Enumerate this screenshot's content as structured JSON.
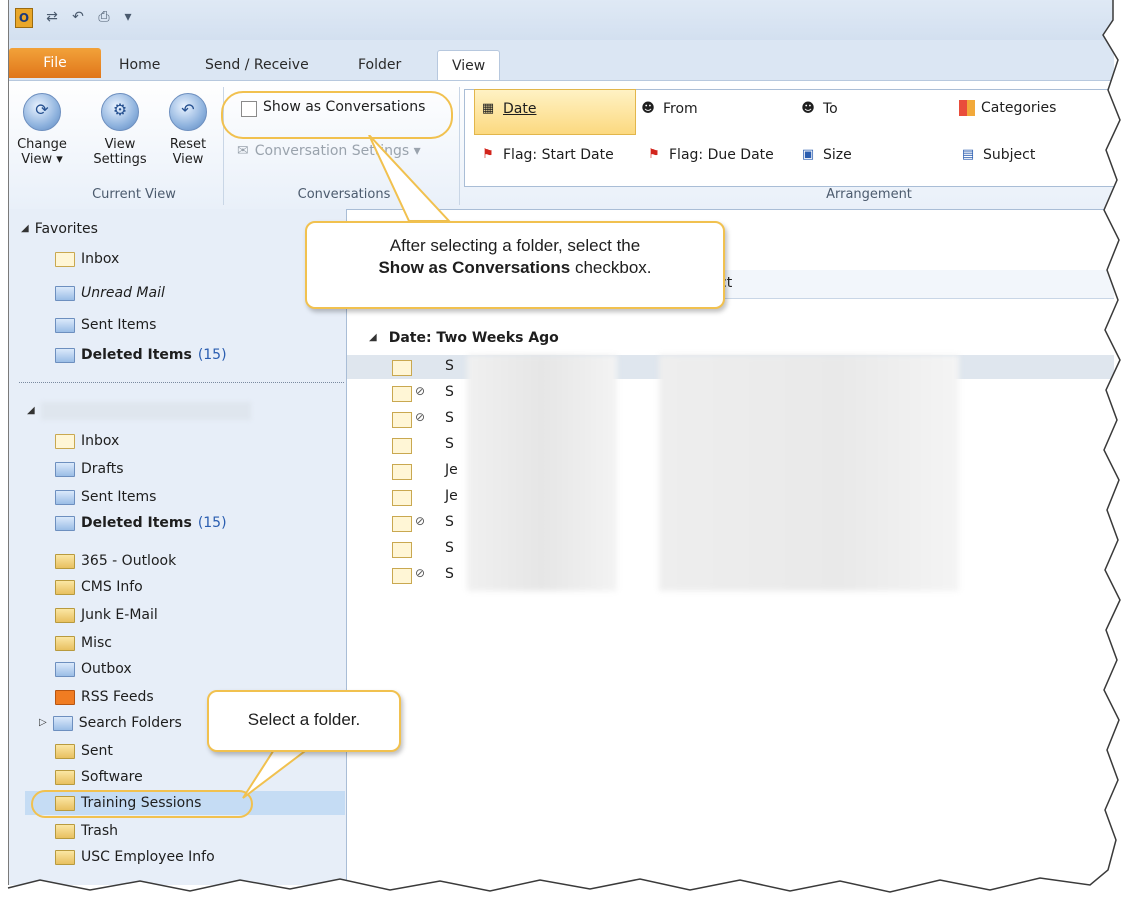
{
  "qat": {
    "app_letter": "O",
    "undo": "↶",
    "print": "⎙",
    "more": "▾"
  },
  "tabs": {
    "file": "File",
    "home": "Home",
    "send_receive": "Send / Receive",
    "folder": "Folder",
    "view": "View"
  },
  "ribbon": {
    "change_view": "Change View ▾",
    "view_settings": "View Settings",
    "reset_view": "Reset View",
    "current_view_label": "Current View",
    "show_as_conversations": "Show as Conversations",
    "conversation_settings": "Conversation Settings ▾",
    "conversations_label": "Conversations",
    "arrangement_label": "Arrangement",
    "arrange": {
      "date": "Date",
      "from": "From",
      "to": "To",
      "categories": "Categories",
      "flag_start": "Flag: Start Date",
      "flag_due": "Flag: Due Date",
      "size": "Size",
      "subject": "Subject"
    }
  },
  "callouts": {
    "conversations_line1": "After selecting a folder, select the",
    "conversations_bold": "Show as Conversations",
    "conversations_tail": " checkbox.",
    "select_folder": "Select a folder."
  },
  "nav": {
    "favorites_header": "Favorites",
    "favorites": [
      "Inbox",
      "Unread Mail",
      "Sent Items",
      "Deleted Items"
    ],
    "deleted_count": "(15)",
    "folders": [
      "Inbox",
      "Drafts",
      "Sent Items",
      "Deleted Items",
      "365 - Outlook",
      "CMS Info",
      "Junk E-Mail",
      "Misc",
      "Outbox",
      "RSS Feeds",
      "Search Folders",
      "Sent",
      "Software",
      "Training Sessions",
      "Trash",
      "USC Employee Info"
    ],
    "deleted_count2": "(15)"
  },
  "list": {
    "header_fragment": "ct",
    "group_label": "Date: Two Weeks Ago",
    "rows": [
      {
        "initial": "S",
        "attach": false
      },
      {
        "initial": "S",
        "attach": true
      },
      {
        "initial": "S",
        "attach": true
      },
      {
        "initial": "S",
        "attach": false
      },
      {
        "initial": "Je",
        "attach": false
      },
      {
        "initial": "Je",
        "attach": false
      },
      {
        "initial": "S",
        "attach": true
      },
      {
        "initial": "S",
        "attach": false
      },
      {
        "initial": "S",
        "attach": true
      }
    ]
  }
}
